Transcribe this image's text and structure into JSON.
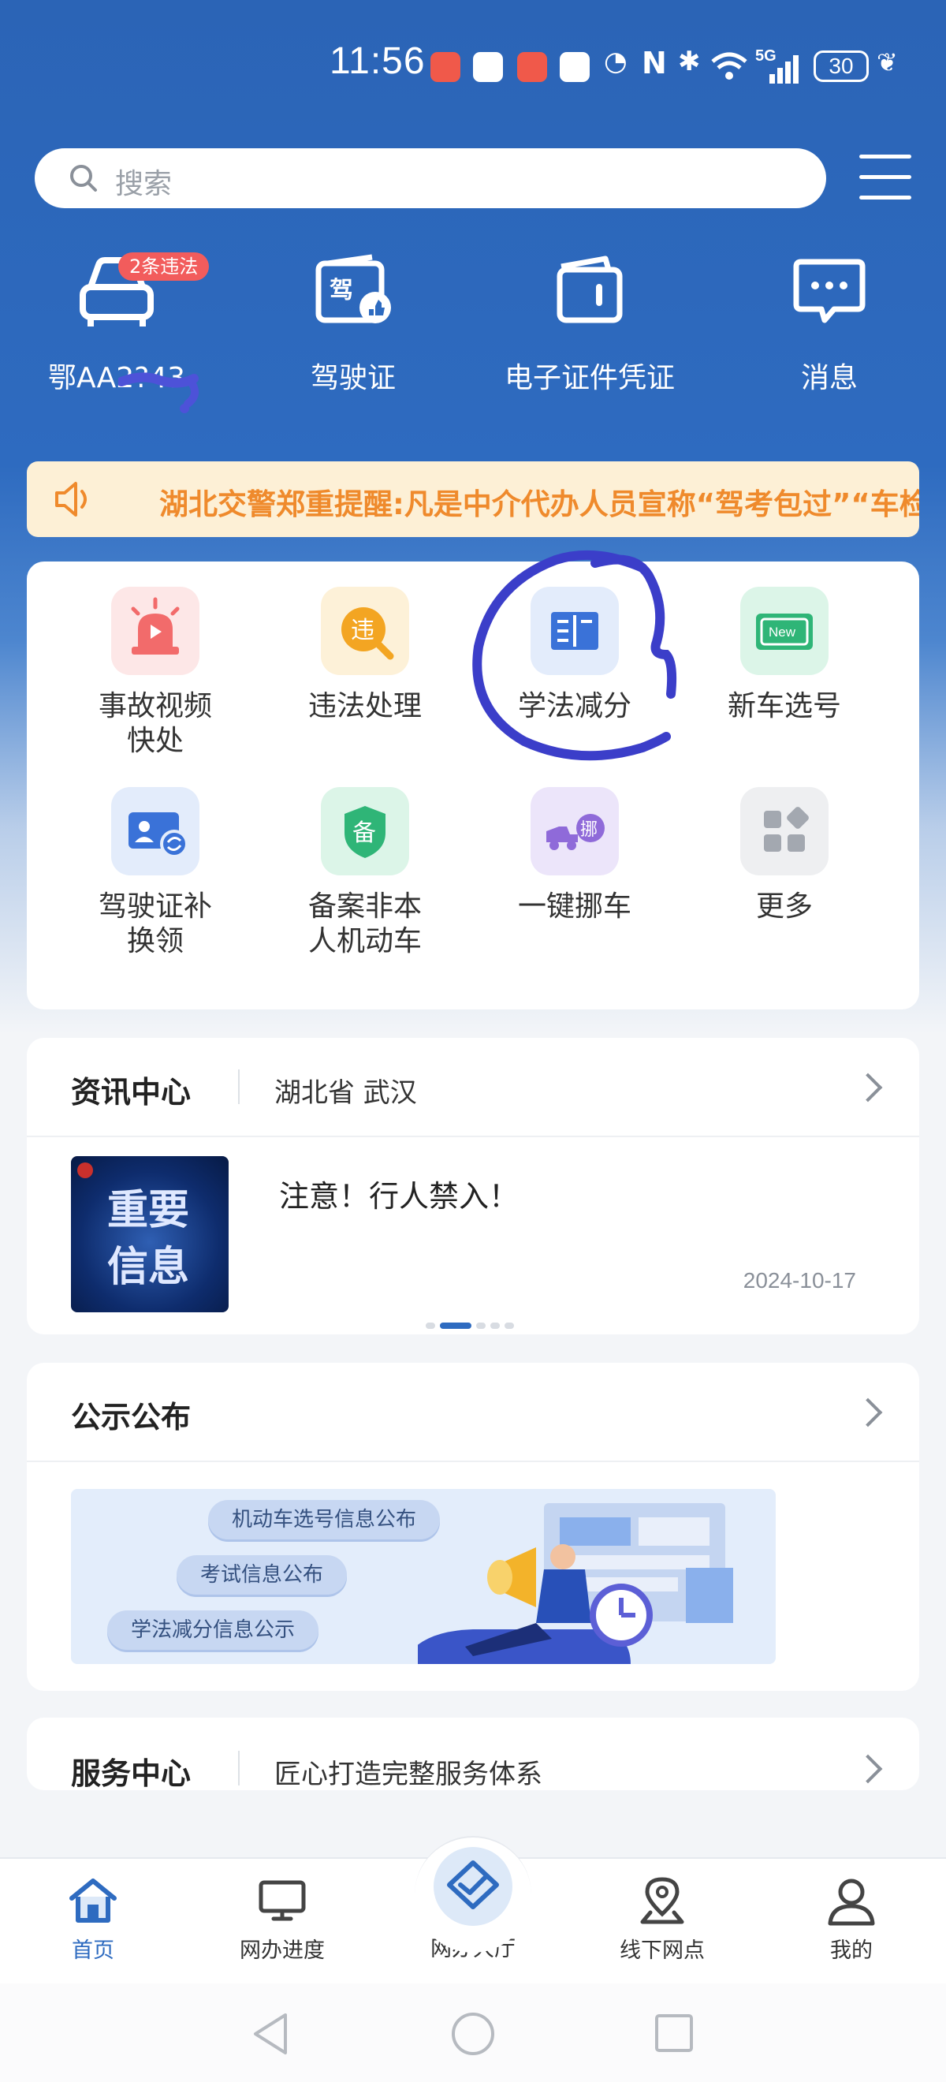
{
  "status_bar": {
    "time": "11:56",
    "battery": "30",
    "network": "5G",
    "nfc": "N"
  },
  "search": {
    "placeholder": "搜索"
  },
  "shortcuts": [
    {
      "label": "鄂AA2?43",
      "icon": "car-icon"
    },
    {
      "label": "驾驶证",
      "icon": "license-icon"
    },
    {
      "label": "电子证件凭证",
      "icon": "wallet-icon"
    },
    {
      "label": "消息",
      "icon": "message-icon"
    }
  ],
  "violation_badge": "2条违法",
  "notice": {
    "text": "湖北交警郑重提醒:凡是中介代办人员宣称“驾考包过”“车检"
  },
  "services": [
    {
      "label": "事故视频\n快处",
      "icon": "alarm-icon",
      "color": "#f26b6b",
      "bg": "#fde7e7"
    },
    {
      "label": "违法处理",
      "icon": "violation-icon",
      "color": "#f3a522",
      "bg": "#fdf1d8"
    },
    {
      "label": "学法减分",
      "icon": "book-icon",
      "color": "#3a72d8",
      "bg": "#e3ecfb"
    },
    {
      "label": "新车选号",
      "icon": "new-plate-icon",
      "color": "#2fb577",
      "bg": "#dcf5e8"
    },
    {
      "label": "驾驶证补\n换领",
      "icon": "id-card-icon",
      "color": "#3a72d8",
      "bg": "#e3ecfb"
    },
    {
      "label": "备案非本\n人机动车",
      "icon": "shield-icon",
      "color": "#2fb577",
      "bg": "#dcf5e8"
    },
    {
      "label": "一键挪车",
      "icon": "tow-truck-icon",
      "color": "#8f6ad9",
      "bg": "#ece5fa"
    },
    {
      "label": "更多",
      "icon": "grid-icon",
      "color": "#9aa0a8",
      "bg": "#eeeff1"
    }
  ],
  "news": {
    "title": "资讯中心",
    "region": "湖北省 武汉",
    "item_title": "注意！行人禁入！",
    "item_date": "2024-10-17",
    "thumb_text_1": "重要",
    "thumb_text_2": "信息"
  },
  "public": {
    "title": "公示公布",
    "pills": [
      "机动车选号信息公布",
      "考试信息公布",
      "学法减分信息公示"
    ]
  },
  "service_center": {
    "title": "服务中心",
    "subtitle": "匠心打造完整服务体系"
  },
  "bottom_nav": [
    {
      "label": "首页",
      "icon": "home-icon",
      "active": true
    },
    {
      "label": "网办进度",
      "icon": "monitor-icon",
      "active": false
    },
    {
      "label": "网办大厅",
      "icon": "hall-icon",
      "active": false
    },
    {
      "label": "线下网点",
      "icon": "location-icon",
      "active": false
    },
    {
      "label": "我的",
      "icon": "user-icon",
      "active": false
    }
  ],
  "colors": {
    "brand_blue": "#2e6bc0",
    "notice_orange": "#ef8a2c",
    "badge_red": "#f25c5c",
    "annotation_blue": "#3b3ec9"
  }
}
